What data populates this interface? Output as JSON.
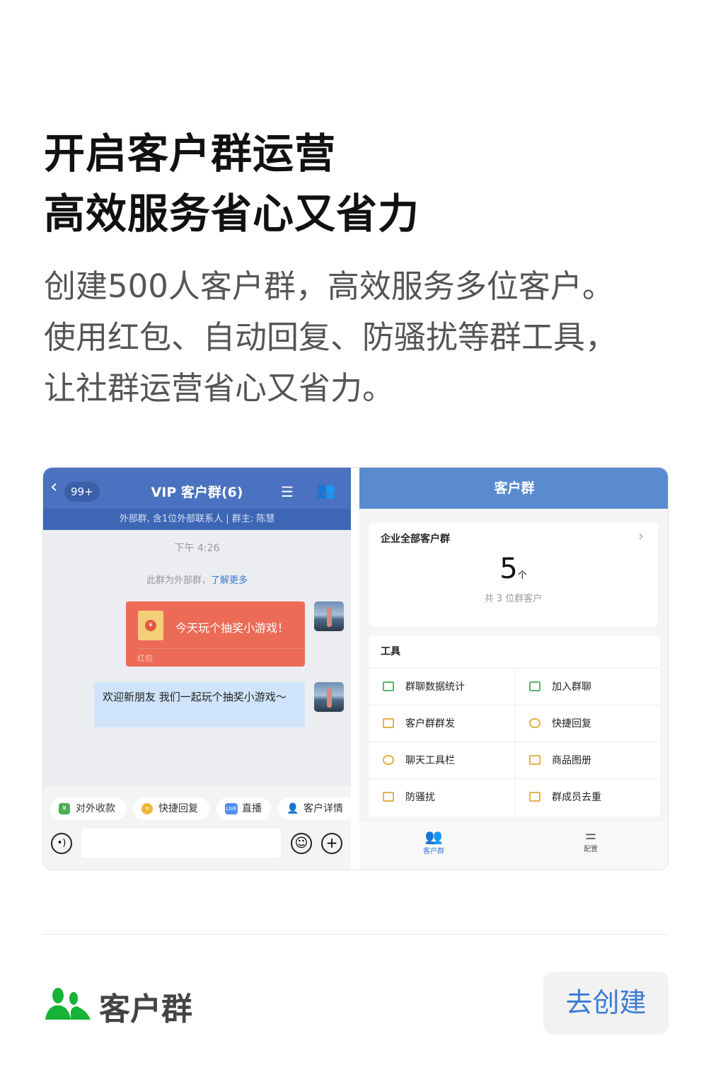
{
  "headline": {
    "line1": "开启客户群运营",
    "line2": "高效服务省心又省力"
  },
  "description": [
    "创建500人客户群，高效服务多位客户。",
    "使用红包、自动回复、防骚扰等群工具，",
    "让社群运营省心又省力。"
  ],
  "chat": {
    "back_badge": "99+",
    "title": "VIP 客户群(6)",
    "subtitle": "外部群, 含1位外部联系人 | 群主: 陈慧",
    "timestamp": "下午 4:26",
    "system_text": "此群为外部群，",
    "system_link": "了解更多",
    "red_packet": {
      "text": "今天玩个抽奖小游戏！",
      "label": "红包"
    },
    "message": "欢迎新朋友 我们一起玩个抽奖小游戏～",
    "chips": [
      {
        "label": "对外收款",
        "icon": "yuan-shield-icon"
      },
      {
        "label": "快捷回复",
        "icon": "quick-reply-icon"
      },
      {
        "label": "直播",
        "icon": "live-icon",
        "badge": "LIVE"
      },
      {
        "label": "客户详情",
        "icon": "customer-detail-icon"
      }
    ]
  },
  "groups": {
    "title": "客户群",
    "summary": {
      "label": "企业全部客户群",
      "count": "5",
      "unit": "个",
      "sub": "共 3 位群客户"
    },
    "tools_title": "工具",
    "tools": [
      {
        "label": "群聊数据统计",
        "icon": "chart-icon"
      },
      {
        "label": "加入群聊",
        "icon": "qr-code-icon"
      },
      {
        "label": "客户群群发",
        "icon": "broadcast-icon"
      },
      {
        "label": "快捷回复",
        "icon": "chat-bubble-icon"
      },
      {
        "label": "聊天工具栏",
        "icon": "toolbar-icon"
      },
      {
        "label": "商品图册",
        "icon": "catalog-icon"
      },
      {
        "label": "防骚扰",
        "icon": "anti-spam-icon"
      },
      {
        "label": "群成员去重",
        "icon": "dedupe-icon"
      }
    ],
    "tabs": [
      {
        "label": "客户群",
        "active": true
      },
      {
        "label": "配置",
        "active": false
      }
    ]
  },
  "footer": {
    "label": "客户群",
    "button": "去创建"
  },
  "colors": {
    "accent": "#3a7bd5",
    "green": "#16b436",
    "red_packet": "#ec6b57",
    "chat_header": "#4a72c0"
  }
}
